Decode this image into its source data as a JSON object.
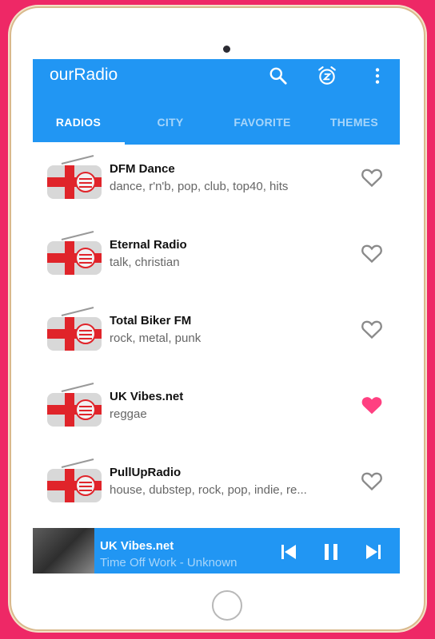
{
  "app": {
    "title": "ourRadio",
    "actions": [
      {
        "icon": "search-icon"
      },
      {
        "icon": "alarm-snooze-icon"
      },
      {
        "icon": "more-vert-icon"
      }
    ],
    "accent": "#2196f3",
    "background": "#ee2866"
  },
  "tabs": [
    {
      "label": "RADIOS",
      "active": true
    },
    {
      "label": "CITY",
      "active": false
    },
    {
      "label": "FAVORITE",
      "active": false
    },
    {
      "label": "THEMES",
      "active": false
    }
  ],
  "stations": [
    {
      "name": "DFM Dance",
      "genres": "dance,  r'n'b, pop, club, top40, hits",
      "favorite": false
    },
    {
      "name": "Eternal Radio",
      "genres": "talk, christian",
      "favorite": false
    },
    {
      "name": "Total Biker FM",
      "genres": "rock, metal, punk",
      "favorite": false
    },
    {
      "name": "UK Vibes.net",
      "genres": "reggae",
      "favorite": true
    },
    {
      "name": "PullUpRadio",
      "genres": "house, dubstep, rock, pop, indie, re...",
      "favorite": false
    }
  ],
  "player": {
    "title": "UK Vibes.net",
    "subtitle": "Time Off Work - Unknown",
    "controls": [
      "skip-previous-icon",
      "pause-icon",
      "skip-next-icon"
    ]
  },
  "colors": {
    "heart_active": "#ff4081",
    "heart_inactive": "#8a8a8a"
  }
}
